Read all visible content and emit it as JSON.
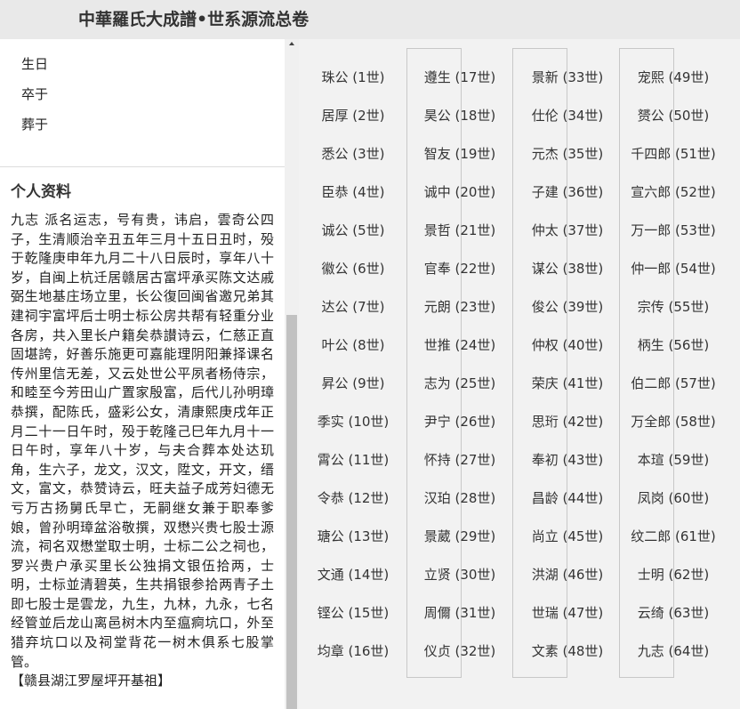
{
  "header": {
    "title": "中華羅氏大成譜•世系源流总卷"
  },
  "left": {
    "top_items": [
      {
        "label": "生日"
      },
      {
        "label": "卒于"
      },
      {
        "label": "葬于"
      }
    ],
    "profile_title": "个人资料",
    "bio": "九志 派名运志，号有贵，讳启，雲奇公四子，生清顺治辛丑五年三月十五日丑时，殁于乾隆庚申年九月二十八日辰时，享年八十岁，自闽上杭迁居赣居古富坪承买陈文达戚弼生地基庄场立里，长公復回闽省邀兄弟其建祠宇富坪后士明士标公房共帮有轻重分业各房，共入里长户籍矣恭讃诗云，仁慈正直固堪誇，好善乐施更可嘉能理阴阳兼择课名传州里信无差，又云处世公平夙者杨侍宗，和睦至今芳田山广置家殷富，后代儿孙明璋恭撰，配陈氏，盛彩公女，清康熙庚戌年正月二十一日午时，殁于乾隆己巳年九月十一日午时，享年八十岁，与夫合葬本处达玑角，生六子，龙文，汉文，陞文，开文，缙文，富文，恭赞诗云，旺夫益子成芳妇德无亏万古扬舅氏早亡，无嗣继女兼于职奉爹娘，曾孙明璋盆浴敬撰，双懋兴贵七股士源流，祠名双懋堂取士明，士标二公之祠也，罗兴贵户承买里长公独捐文银伍拾两，士明，士标並清碧英，生共捐银参拾两青子土即七股士是雲龙，九生，九林，九永，七名经管並后龙山离邑树木内至瘟痾坑口，外至猎弃坑口以及祠堂背花一树木俱系七股掌管。",
    "bio_note": "【赣县湖江罗屋坪开基祖】"
  },
  "generations": {
    "col1": [
      "珠公 (1世)",
      "居厚 (2世)",
      "悉公 (3世)",
      "臣恭 (4世)",
      "诚公 (5世)",
      "徽公 (6世)",
      "达公 (7世)",
      "叶公 (8世)",
      "昇公 (9世)",
      "季实 (10世)",
      "霄公 (11世)",
      "令恭 (12世)",
      "瑭公 (13世)",
      "文通 (14世)",
      "铿公 (15世)",
      "均章 (16世)"
    ],
    "col2": [
      "遵生 (17世)",
      "昊公 (18世)",
      "智友 (19世)",
      "诚中 (20世)",
      "景哲 (21世)",
      "官奉 (22世)",
      "元朗 (23世)",
      "世推 (24世)",
      "志为 (25世)",
      "尹宁 (26世)",
      "怀持 (27世)",
      "汉珀 (28世)",
      "景葳 (29世)",
      "立贤 (30世)",
      "周儞 (31世)",
      "仪贞 (32世)"
    ],
    "col3": [
      "景新 (33世)",
      "仕伦 (34世)",
      "元杰 (35世)",
      "子建 (36世)",
      "仲太 (37世)",
      "谋公 (38世)",
      "俊公 (39世)",
      "仲权 (40世)",
      "荣庆 (41世)",
      "思珩 (42世)",
      "奉初 (43世)",
      "昌龄 (44世)",
      "尚立 (45世)",
      "洪湖 (46世)",
      "世瑞 (47世)",
      "文素 (48世)"
    ],
    "col4": [
      "宠熙 (49世)",
      "赟公 (50世)",
      "千四郎 (51世)",
      "宣六郎 (52世)",
      "万一郎 (53世)",
      "仲一郎 (54世)",
      "宗传 (55世)",
      "柄生 (56世)",
      "伯二郎 (57世)",
      "万全郎 (58世)",
      "本瑄 (59世)",
      "凤岗 (60世)",
      "纹二郎 (61世)",
      "士明 (62世)",
      "云绮 (63世)",
      "九志 (64世)"
    ]
  }
}
